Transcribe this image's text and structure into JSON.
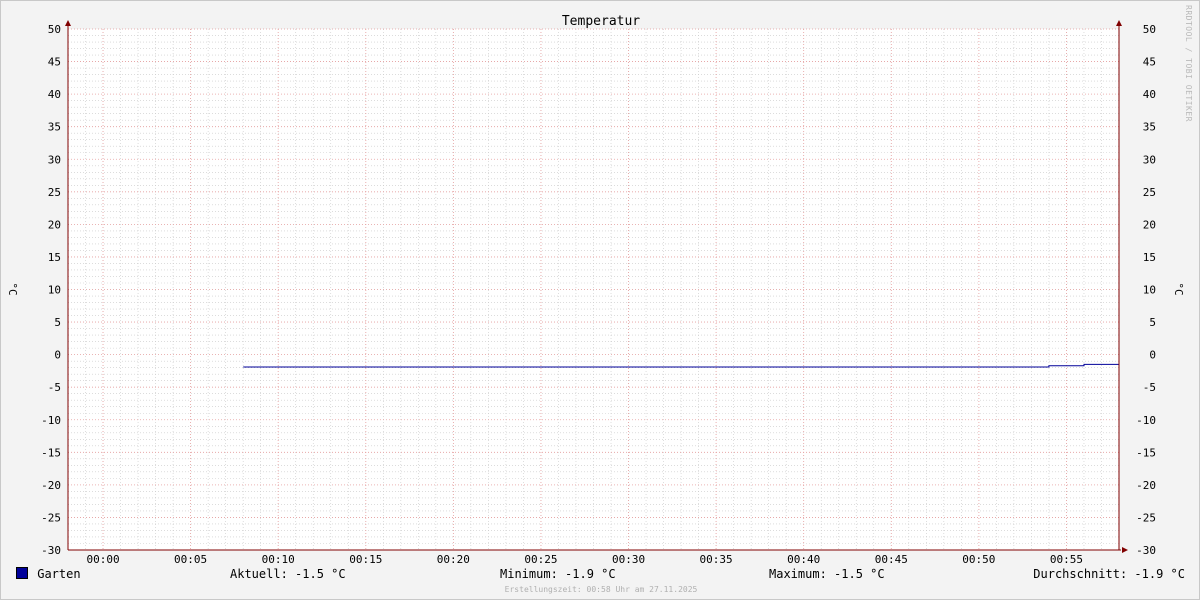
{
  "chart_data": {
    "type": "line",
    "title": "Temperatur",
    "ylabel": "°C",
    "xlabel": "",
    "ylim": [
      -30,
      50
    ],
    "y_ticks": [
      50,
      45,
      40,
      35,
      30,
      25,
      20,
      15,
      10,
      5,
      0,
      -5,
      -10,
      -15,
      -20,
      -25,
      -30
    ],
    "x_range": [
      "23:58",
      "00:58"
    ],
    "x_ticks": [
      "00:00",
      "00:05",
      "00:10",
      "00:15",
      "00:20",
      "00:25",
      "00:30",
      "00:35",
      "00:40",
      "00:45",
      "00:50",
      "00:55"
    ],
    "grid": true,
    "series": [
      {
        "name": "Garten",
        "color": "#000099",
        "x": [
          "00:08",
          "00:54",
          "00:54",
          "00:56",
          "00:56",
          "00:58"
        ],
        "values": [
          -1.9,
          -1.9,
          -1.7,
          -1.7,
          -1.5,
          -1.5
        ]
      }
    ],
    "colors": {
      "background": "#f3f3f3",
      "plot_background": "#ffffff",
      "major_grid": "#e8a0a0",
      "minor_grid": "#c8c8c8",
      "axis": "#800000"
    }
  },
  "watermark": "RRDTOOL / TOBI OETIKER",
  "legend": {
    "series_name": "Garten",
    "current": "Aktuell: -1.5 °C",
    "minimum": "Minimum: -1.9 °C",
    "maximum": "Maximum: -1.5 °C",
    "average": "Durchschnitt: -1.9 °C"
  },
  "footer": "Erstellungszeit: 00:58 Uhr am 27.11.2025"
}
